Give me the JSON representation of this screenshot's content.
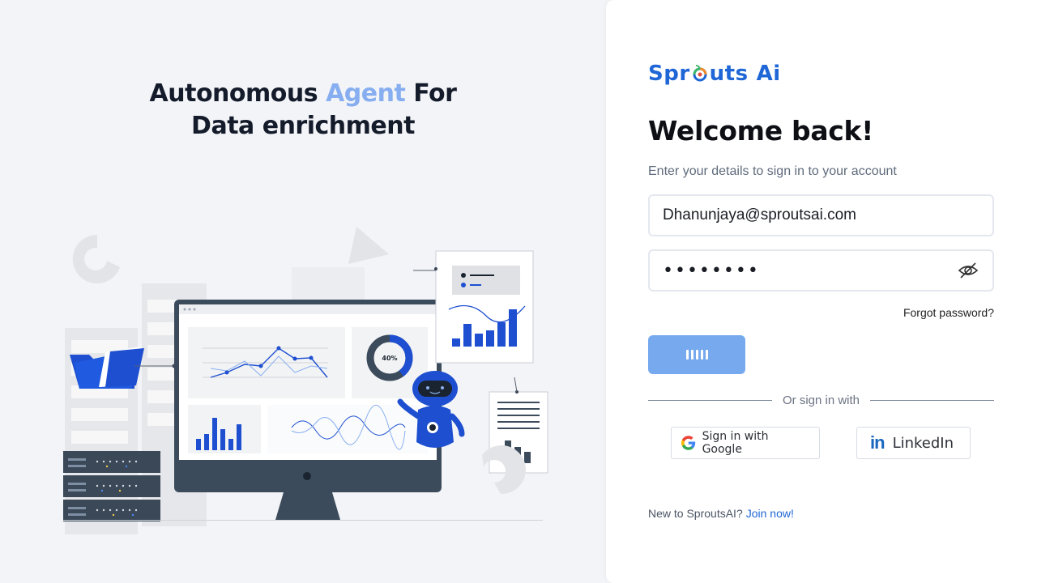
{
  "hero": {
    "title_part1": "Autonomous ",
    "title_accent": "Agent",
    "title_part3": " For",
    "title_line2": "Data enrichment",
    "donut_label": "40%"
  },
  "brand": {
    "logo_left": "Spr",
    "logo_mid": "uts",
    "logo_right": "Ai",
    "colors": {
      "primary": "#1f66d6",
      "accent": "#86aef0",
      "button": "#76a9ee"
    }
  },
  "login": {
    "heading": "Welcome back!",
    "subtitle": "Enter your details to sign in to your account",
    "email_value": "Dhanunjaya@sproutsai.com",
    "password_mask": "••••••••",
    "forgot_label": "Forgot password?",
    "divider_label": "Or sign in with",
    "google_label": "Sign in with Google",
    "linkedin_label": "LinkedIn",
    "linkedin_logo": "in",
    "new_user_label": "New to SproutsAI?",
    "join_label": "Join now!"
  }
}
